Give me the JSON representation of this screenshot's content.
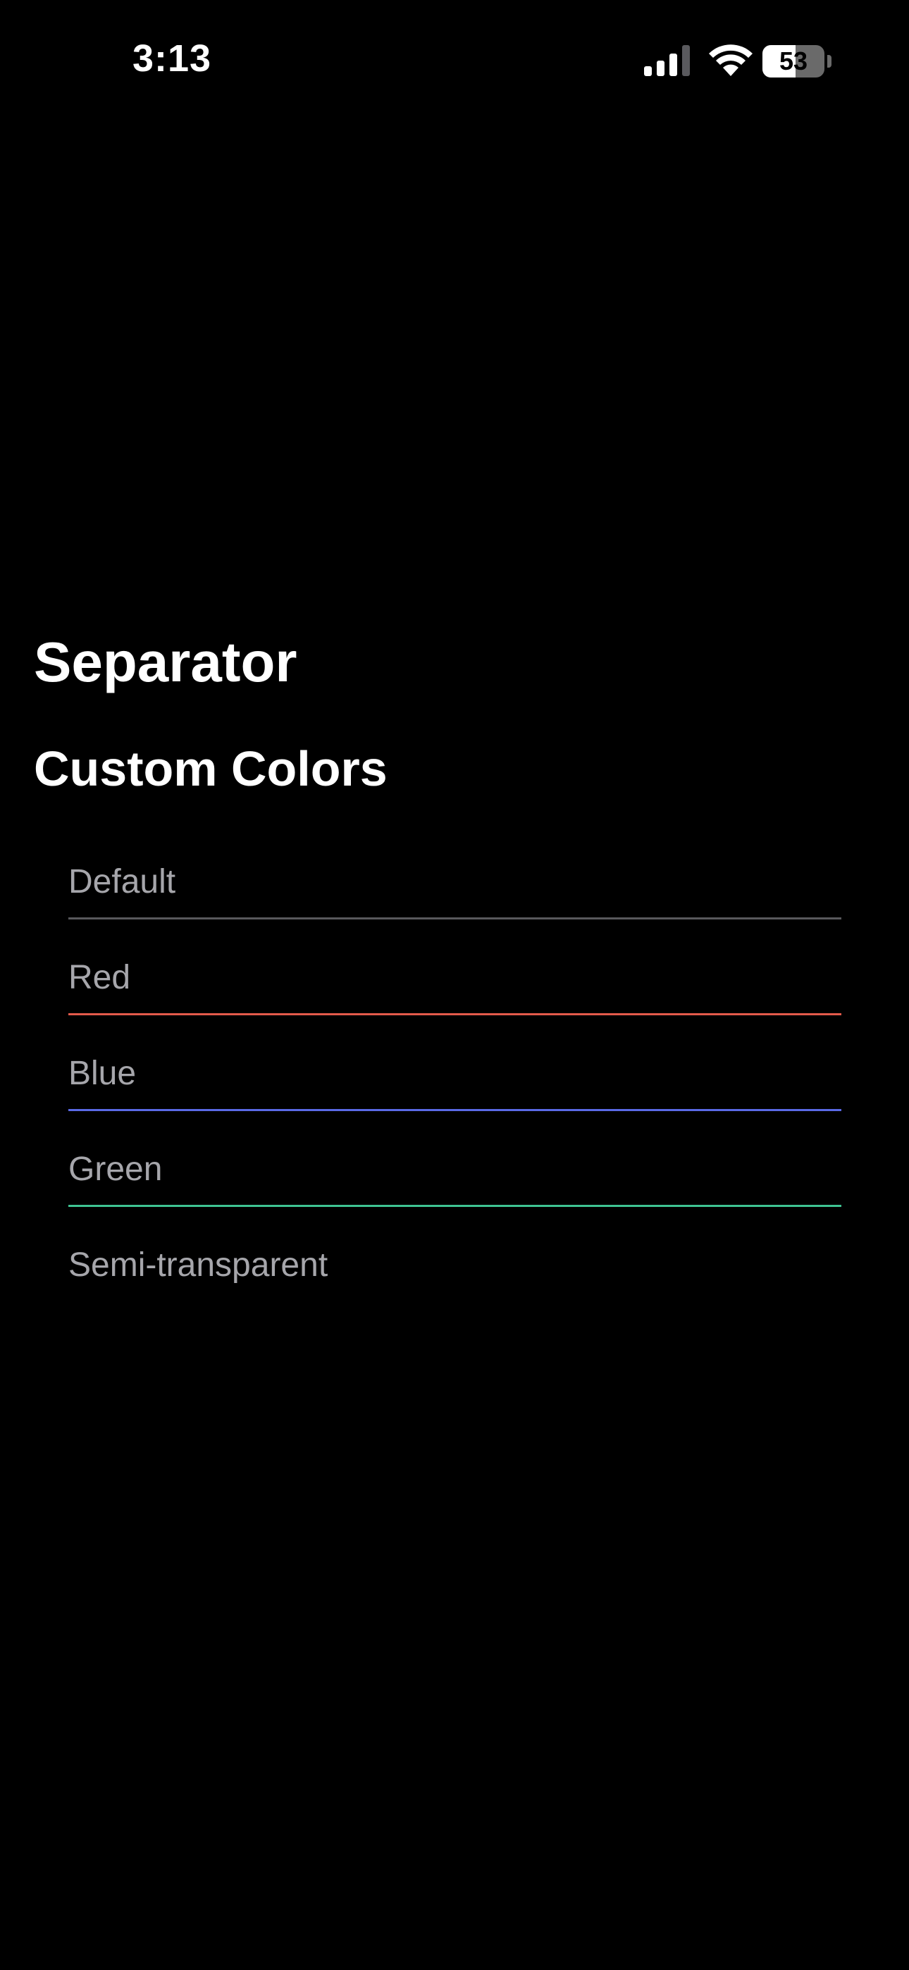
{
  "status_bar": {
    "time": "3:13",
    "battery_level": "53",
    "battery_fraction": 0.53,
    "signal_bars_active": 3,
    "signal_bars_total": 4
  },
  "title": "Separator",
  "section": "Custom Colors",
  "separators": [
    {
      "label": "Default",
      "color": "#58585c",
      "visible": true
    },
    {
      "label": "Red",
      "color": "#e35a4b",
      "visible": true
    },
    {
      "label": "Blue",
      "color": "#5a6ae6",
      "visible": true
    },
    {
      "label": "Green",
      "color": "#3fc392",
      "visible": true
    },
    {
      "label": "Semi-transparent",
      "color": "rgba(255,255,255,0.0)",
      "visible": false
    }
  ],
  "colors": {
    "background": "#000000",
    "text_primary": "#ffffff",
    "text_secondary": "#a6a6ab"
  },
  "icons": {
    "signal": "cellular-signal-icon",
    "wifi": "wifi-icon",
    "battery": "battery-icon"
  }
}
